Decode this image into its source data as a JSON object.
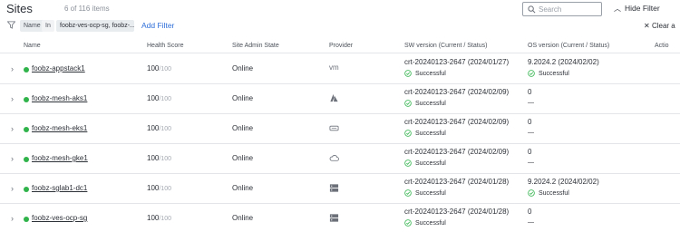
{
  "header": {
    "title": "Sites",
    "count": "6 of 116 items",
    "search_placeholder": "Search",
    "hide_filter_label": "Hide Filter"
  },
  "filter": {
    "field": "Name",
    "operator": "In",
    "value": "foobz-ves-ocp-sg, foobz-...",
    "add_label": "Add Filter",
    "clear_label": "Clear a"
  },
  "columns": {
    "name": "Name",
    "health": "Health Score",
    "admin_state": "Site Admin State",
    "provider": "Provider",
    "sw_version": "SW version (Current / Status)",
    "os_version": "OS version (Current / Status)",
    "actions": "Actio"
  },
  "rows": [
    {
      "name": "foobz-appstack1",
      "health": "100",
      "health_max": "/100",
      "admin_state": "Online",
      "provider_icon": "vm-icon",
      "provider_text": "vm",
      "sw_version": "crt-20240123-2647 (2024/01/27)",
      "sw_status": "Successful",
      "os_version": "9.2024.2 (2024/02/02)",
      "os_status": "Successful"
    },
    {
      "name": "foobz-mesh-aks1",
      "health": "100",
      "health_max": "/100",
      "admin_state": "Online",
      "provider_icon": "azure-icon",
      "provider_text": "",
      "sw_version": "crt-20240123-2647 (2024/02/09)",
      "sw_status": "Successful",
      "os_version": "0",
      "os_status": "—"
    },
    {
      "name": "foobz-mesh-eks1",
      "health": "100",
      "health_max": "/100",
      "admin_state": "Online",
      "provider_icon": "aws-icon",
      "provider_text": "",
      "sw_version": "crt-20240123-2647 (2024/02/09)",
      "sw_status": "Successful",
      "os_version": "0",
      "os_status": "—"
    },
    {
      "name": "foobz-mesh-gke1",
      "health": "100",
      "health_max": "/100",
      "admin_state": "Online",
      "provider_icon": "cloud-icon",
      "provider_text": "",
      "sw_version": "crt-20240123-2647 (2024/02/09)",
      "sw_status": "Successful",
      "os_version": "0",
      "os_status": "—"
    },
    {
      "name": "foobz-sglab1-dc1",
      "health": "100",
      "health_max": "/100",
      "admin_state": "Online",
      "provider_icon": "server-icon",
      "provider_text": "",
      "sw_version": "crt-20240123-2647 (2024/01/28)",
      "sw_status": "Successful",
      "os_version": "9.2024.2 (2024/02/02)",
      "os_status": "Successful"
    },
    {
      "name": "foobz-ves-ocp-sg",
      "health": "100",
      "health_max": "/100",
      "admin_state": "Online",
      "provider_icon": "server-icon",
      "provider_text": "",
      "sw_version": "crt-20240123-2647 (2024/01/28)",
      "sw_status": "Successful",
      "os_version": "0",
      "os_status": "—"
    }
  ],
  "colors": {
    "online_dot": "#2fb34a",
    "success": "#2fb34a",
    "link": "#2e6ed8"
  }
}
